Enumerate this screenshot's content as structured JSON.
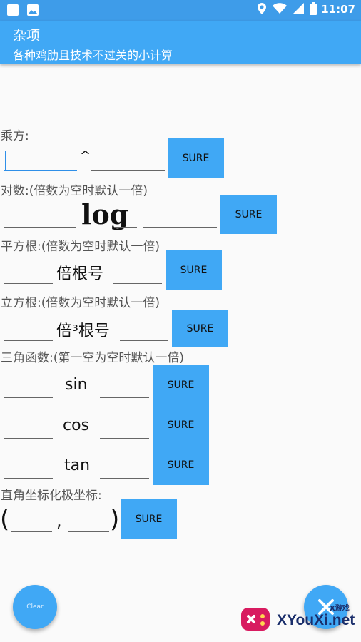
{
  "status_bar": {
    "time": "11:07",
    "icons": [
      "app-notification-icon",
      "image-notification-icon",
      "location-icon",
      "wifi-icon",
      "battery-icon"
    ]
  },
  "appbar": {
    "title": "杂项",
    "subtitle": "各种鸡肋且技术不过关的小计算"
  },
  "sections": {
    "power": {
      "label": "乘方:",
      "operator": "^",
      "button": "SURE"
    },
    "log": {
      "label": "对数:(倍数为空时默认一倍)",
      "operator": "log",
      "button": "SURE"
    },
    "sqrt": {
      "label": "平方根:(倍数为空时默认一倍)",
      "operator": "倍根号",
      "button": "SURE"
    },
    "cbrt": {
      "label": "立方根:(倍数为空时默认一倍)",
      "operator": "倍³根号",
      "button": "SURE"
    },
    "trig": {
      "label": "三角函数:(第一空为空时默认一倍)",
      "rows": [
        {
          "fn": "sin",
          "button": "SURE"
        },
        {
          "fn": "cos",
          "button": "SURE"
        },
        {
          "fn": "tan",
          "button": "SURE"
        }
      ]
    },
    "polar": {
      "label": "直角坐标化极坐标:",
      "open": "(",
      "comma": ",",
      "close": ")",
      "button": "SURE"
    }
  },
  "fab": {
    "clear_label": "Clear"
  },
  "watermark": {
    "text": "XYouXi.net",
    "small": "X游戏"
  },
  "colors": {
    "accent": "#40a8f5",
    "status_bar": "#3e9ce9",
    "cursor": "#2f8fe8"
  }
}
